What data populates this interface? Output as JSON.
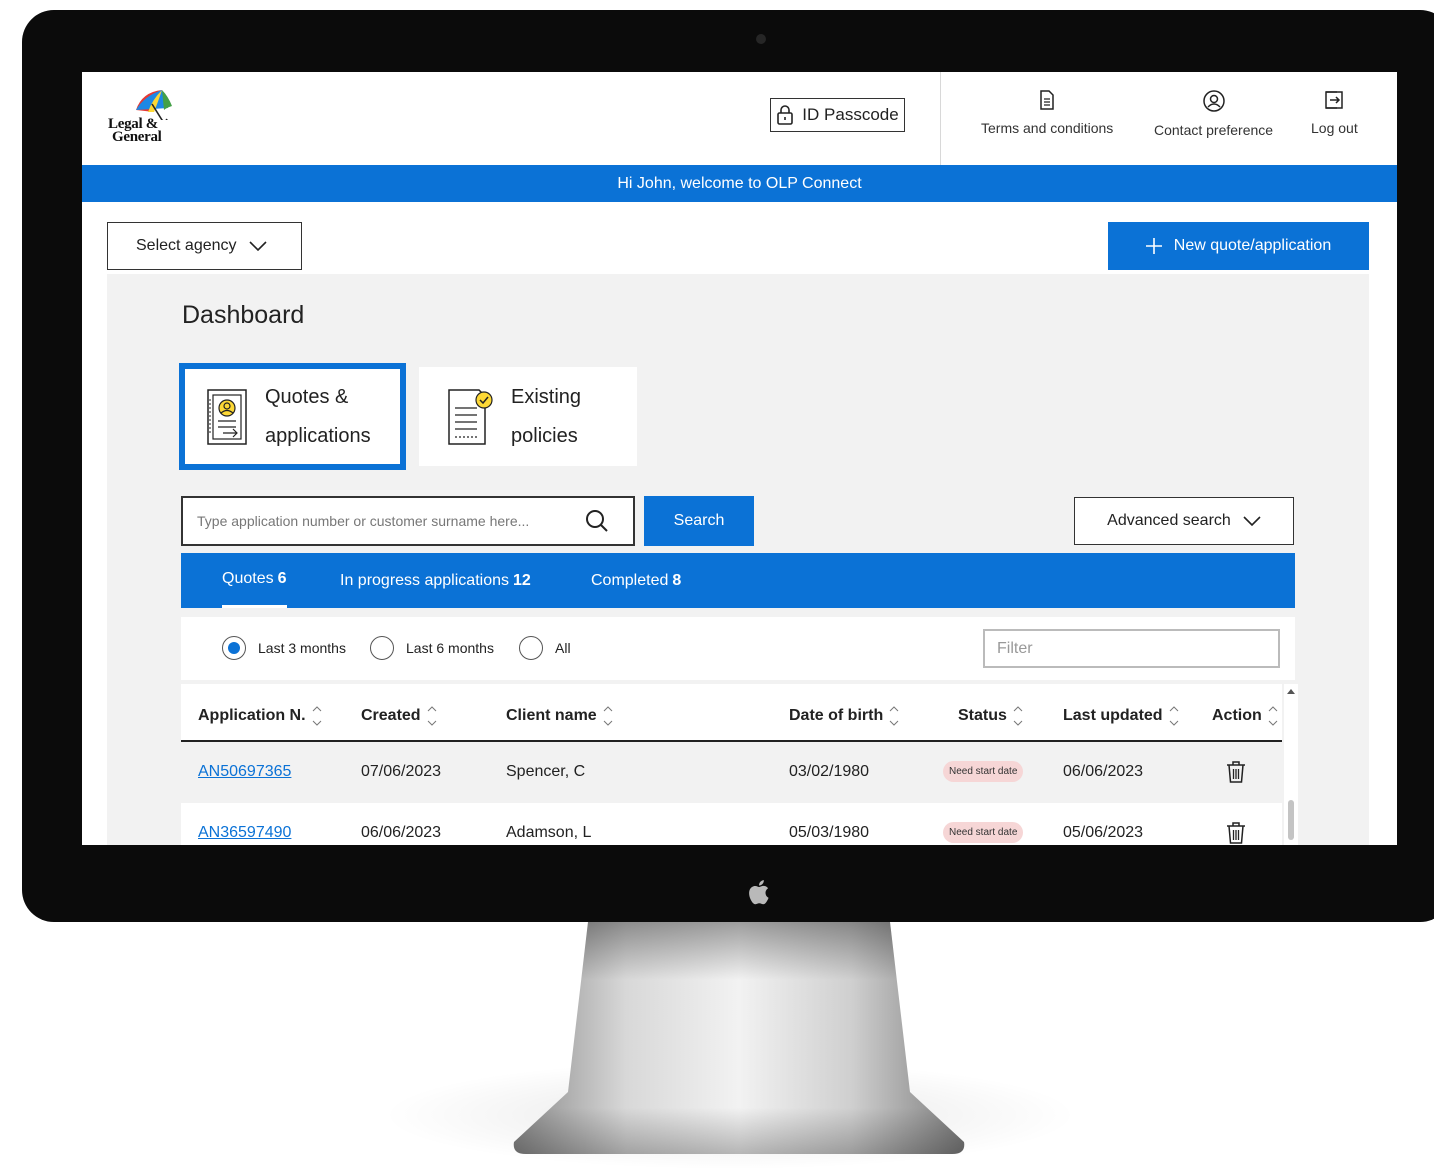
{
  "logo": {
    "line1": "Legal &",
    "line2": "General"
  },
  "header": {
    "passcode_label": "ID Passcode",
    "links": [
      {
        "label": "Terms and conditions",
        "icon": "document-icon"
      },
      {
        "label": "Contact preference",
        "icon": "user-circle-icon"
      },
      {
        "label": "Log out",
        "icon": "logout-icon"
      }
    ]
  },
  "welcome": "Hi John, welcome to OLP Connect",
  "toolbar": {
    "agency_label": "Select agency",
    "new_label": "New quote/application"
  },
  "dashboard": {
    "title": "Dashboard",
    "cards": [
      {
        "line1": "Quotes &",
        "line2": "applications",
        "selected": true
      },
      {
        "line1": "Existing",
        "line2": "policies",
        "selected": false
      }
    ]
  },
  "search": {
    "placeholder": "Type application number or customer surname here...",
    "button": "Search",
    "advanced": "Advanced search"
  },
  "tabs": [
    {
      "label": "Quotes",
      "count": "6",
      "active": true
    },
    {
      "label": "In progress applications",
      "count": "12",
      "active": false
    },
    {
      "label": "Completed",
      "count": "8",
      "active": false
    }
  ],
  "period": {
    "options": [
      "Last 3 months",
      "Last 6 months",
      "All"
    ],
    "selected": "Last 3 months"
  },
  "filter": {
    "placeholder": "Filter"
  },
  "table": {
    "columns": [
      "Application N.",
      "Created",
      "Client name",
      "Date of birth",
      "Status",
      "Last updated",
      "Action"
    ],
    "rows": [
      {
        "app": "AN50697365",
        "created": "07/06/2023",
        "client": "Spencer, C",
        "dob": "03/02/1980",
        "status": "Need start date",
        "updated": "06/06/2023"
      },
      {
        "app": "AN36597490",
        "created": "06/06/2023",
        "client": "Adamson, L",
        "dob": "05/03/1980",
        "status": "Need start date",
        "updated": "05/06/2023"
      }
    ]
  },
  "colors": {
    "primary": "#0b72d6",
    "badge_bg": "#f6d6d6",
    "bezel": "#0b0b0b"
  }
}
